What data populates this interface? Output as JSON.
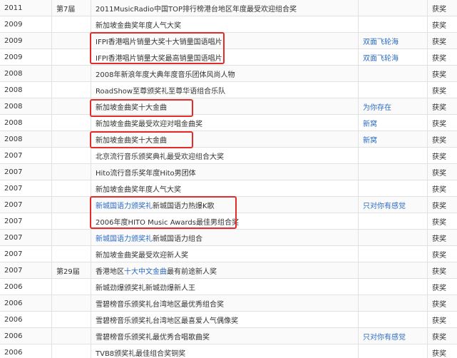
{
  "rows": [
    {
      "year": "2011",
      "session": "第7届",
      "award": "2011MusicRadio中国TOP排行榜港台地区年度最受欢迎组合奖",
      "award_link": "",
      "award_rest": "",
      "work": "",
      "result": "获奖"
    },
    {
      "year": "2009",
      "session": "",
      "award": "新加坡金曲奖年度人气大奖",
      "award_link": "",
      "award_rest": "",
      "work": "",
      "result": "获奖"
    },
    {
      "year": "2009",
      "session": "",
      "award": "IFPI香港唱片销量大奖十大销量国语唱片",
      "award_link": "",
      "award_rest": "",
      "work": "双面飞轮海",
      "result": "获奖"
    },
    {
      "year": "2009",
      "session": "",
      "award": "IFPI香港唱片销量大奖最高销量国语唱片",
      "award_link": "",
      "award_rest": "",
      "work": "双面飞轮海",
      "result": "获奖"
    },
    {
      "year": "2008",
      "session": "",
      "award": "2008年新浪年度大典年度音乐团体风尚人物",
      "award_link": "",
      "award_rest": "",
      "work": "",
      "result": "获奖"
    },
    {
      "year": "2008",
      "session": "",
      "award": "RoadShow至尊颁奖礼至尊华语组合乐队",
      "award_link": "",
      "award_rest": "",
      "work": "",
      "result": "获奖"
    },
    {
      "year": "2008",
      "session": "",
      "award": "新加坡金曲奖十大金曲",
      "award_link": "",
      "award_rest": "",
      "work": "为你存在",
      "result": "获奖"
    },
    {
      "year": "2008",
      "session": "",
      "award": "新加坡金曲奖最受欢迎对唱金曲奖",
      "award_link": "",
      "award_rest": "",
      "work": "新窝",
      "result": "获奖"
    },
    {
      "year": "2008",
      "session": "",
      "award": "新加坡金曲奖十大金曲",
      "award_link": "",
      "award_rest": "",
      "work": "新窝",
      "result": "获奖"
    },
    {
      "year": "2007",
      "session": "",
      "award": "北京流行音乐颁奖典礼最受欢迎组合大奖",
      "award_link": "",
      "award_rest": "",
      "work": "",
      "result": "获奖"
    },
    {
      "year": "2007",
      "session": "",
      "award": "Hito流行音乐奖年度Hito男团体",
      "award_link": "",
      "award_rest": "",
      "work": "",
      "result": "获奖"
    },
    {
      "year": "2007",
      "session": "",
      "award": "新加坡金曲奖年度人气大奖",
      "award_link": "",
      "award_rest": "",
      "work": "",
      "result": "获奖"
    },
    {
      "year": "2007",
      "session": "",
      "award": "",
      "award_link": "新城国语力颁奖礼",
      "award_rest": "新城国语力热爆K歌",
      "work": "只对你有感觉",
      "result": "获奖"
    },
    {
      "year": "2007",
      "session": "",
      "award": "2006年度HITO Music Awards最佳男组合奖",
      "award_link": "",
      "award_rest": "",
      "work": "",
      "result": "获奖"
    },
    {
      "year": "2007",
      "session": "",
      "award": "",
      "award_link": "新城国语力颁奖礼",
      "award_rest": "新城国语力组合",
      "work": "",
      "result": "获奖"
    },
    {
      "year": "2007",
      "session": "",
      "award": "新加坡金曲奖最受欢迎新人奖",
      "award_link": "",
      "award_rest": "",
      "work": "",
      "result": "获奖"
    },
    {
      "year": "2007",
      "session": "第29届",
      "award": "香港地区",
      "award_link": "十大中文金曲",
      "award_rest": "最有前途新人奖",
      "work": "",
      "result": "获奖"
    },
    {
      "year": "2006",
      "session": "",
      "award": "新城劲爆颁奖礼新城劲爆新人王",
      "award_link": "",
      "award_rest": "",
      "work": "",
      "result": "获奖"
    },
    {
      "year": "2006",
      "session": "",
      "award": "雪碧榜音乐颁奖礼台湾地区最优秀组合奖",
      "award_link": "",
      "award_rest": "",
      "work": "",
      "result": "获奖"
    },
    {
      "year": "2006",
      "session": "",
      "award": "雪碧榜音乐颁奖礼台湾地区最喜爱人气偶像奖",
      "award_link": "",
      "award_rest": "",
      "work": "",
      "result": "获奖"
    },
    {
      "year": "2006",
      "session": "",
      "award": "雪碧榜音乐颁奖礼最优秀合唱歌曲奖",
      "award_link": "",
      "award_rest": "",
      "work": "只对你有感觉",
      "result": "获奖"
    },
    {
      "year": "2006",
      "session": "",
      "award": "TVB8颁奖礼最佳组合奖铜奖",
      "award_link": "",
      "award_rest": "",
      "work": "",
      "result": "获奖"
    }
  ],
  "colors": {
    "link": "#2a6bc4",
    "highlight": "#e52a2a",
    "border": "#e1e1e1"
  }
}
